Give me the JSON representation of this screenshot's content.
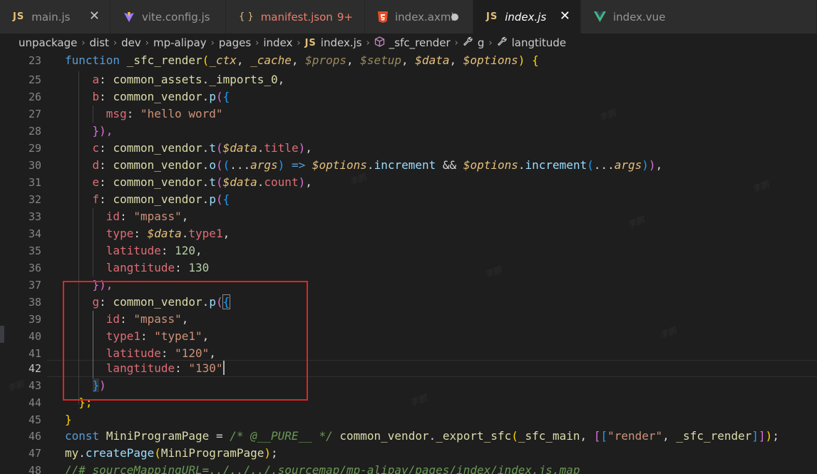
{
  "tabs": [
    {
      "icon": "JS",
      "label": "main.js",
      "italic": false,
      "active": false,
      "has_close": true
    },
    {
      "icon": "vite",
      "label": "vite.config.js",
      "italic": false,
      "active": false
    },
    {
      "icon": "{ }",
      "label": "manifest.json",
      "badge": "9+",
      "warn": true,
      "active": false
    },
    {
      "icon": "html5",
      "label": "index.axml",
      "dirty": true,
      "active": false
    },
    {
      "icon": "JS",
      "label": "index.js",
      "italic": true,
      "active": true,
      "has_close": true
    },
    {
      "icon": "vue",
      "label": "index.vue",
      "active": false
    }
  ],
  "close_glyph": "✕",
  "breadcrumb": [
    {
      "text": "unpackage"
    },
    {
      "text": "dist"
    },
    {
      "text": "dev"
    },
    {
      "text": "mp-alipay"
    },
    {
      "text": "pages"
    },
    {
      "text": "index"
    },
    {
      "icon": "JS",
      "text": "index.js"
    },
    {
      "icon": "cube",
      "text": "_sfc_render"
    },
    {
      "icon": "wrench",
      "text": "g"
    },
    {
      "icon": "wrench",
      "text": "langtitude"
    }
  ],
  "breadcrumb_sep": "›",
  "line_numbers": [
    "23",
    "25",
    "26",
    "27",
    "28",
    "29",
    "30",
    "31",
    "32",
    "33",
    "34",
    "35",
    "36",
    "37",
    "38",
    "39",
    "40",
    "41",
    "42",
    "43",
    "44",
    "45",
    "46",
    "47",
    "48"
  ],
  "current_line": "42",
  "code": {
    "l23": {
      "kw": "function",
      "fn": "_sfc_render",
      "p1": "_ctx",
      "p2": "_cache",
      "p3": "$props",
      "p4": "$setup",
      "p5": "$data",
      "p6": "$options"
    },
    "l25": {
      "k": "a",
      "o": "common_assets",
      "m": "_imports_0"
    },
    "l26": {
      "k": "b",
      "o": "common_vendor",
      "m": "p"
    },
    "l27": {
      "k": "msg",
      "v": "\"hello word\""
    },
    "l28": {
      "t": "}),"
    },
    "l29": {
      "k": "c",
      "o": "common_vendor",
      "m": "t",
      "a": "$data",
      "ap": "title"
    },
    "l30": {
      "k": "d",
      "o": "common_vendor",
      "m": "o",
      "args": "args",
      "opt": "$options",
      "inc": "increment",
      "args2": "args"
    },
    "l31": {
      "k": "e",
      "o": "common_vendor",
      "m": "t",
      "a": "$data",
      "ap": "count"
    },
    "l32": {
      "k": "f",
      "o": "common_vendor",
      "m": "p"
    },
    "l33": {
      "k": "id",
      "v": "\"mpass\""
    },
    "l34": {
      "k": "type",
      "a": "$data",
      "ap": "type1"
    },
    "l35": {
      "k": "latitude",
      "v": "120"
    },
    "l36": {
      "k": "langtitude",
      "v": "130"
    },
    "l37": {
      "t": "}),"
    },
    "l38": {
      "k": "g",
      "o": "common_vendor",
      "m": "p"
    },
    "l39": {
      "k": "id",
      "v": "\"mpass\""
    },
    "l40": {
      "k": "type1",
      "v": "\"type1\""
    },
    "l41": {
      "k": "latitude",
      "v": "\"120\""
    },
    "l42": {
      "k": "langtitude",
      "v": "\"130\""
    },
    "l43": {
      "t": "})"
    },
    "l44": {
      "t": "};"
    },
    "l45": {
      "t": "}"
    },
    "l46": {
      "kw": "const",
      "name": "MiniProgramPage",
      "cm": "/* @__PURE__ */",
      "o": "common_vendor",
      "m": "_export_sfc",
      "a1": "_sfc_main",
      "s": "\"render\"",
      "a2": "_sfc_render"
    },
    "l47": {
      "o": "my",
      "m": "createPage",
      "a": "MiniProgramPage"
    },
    "l48": {
      "cm": "//# sourceMappingURL=../../../.sourcemap/mp-alipay/pages/index/index.js.map"
    }
  },
  "watermark_text": "李鹏"
}
